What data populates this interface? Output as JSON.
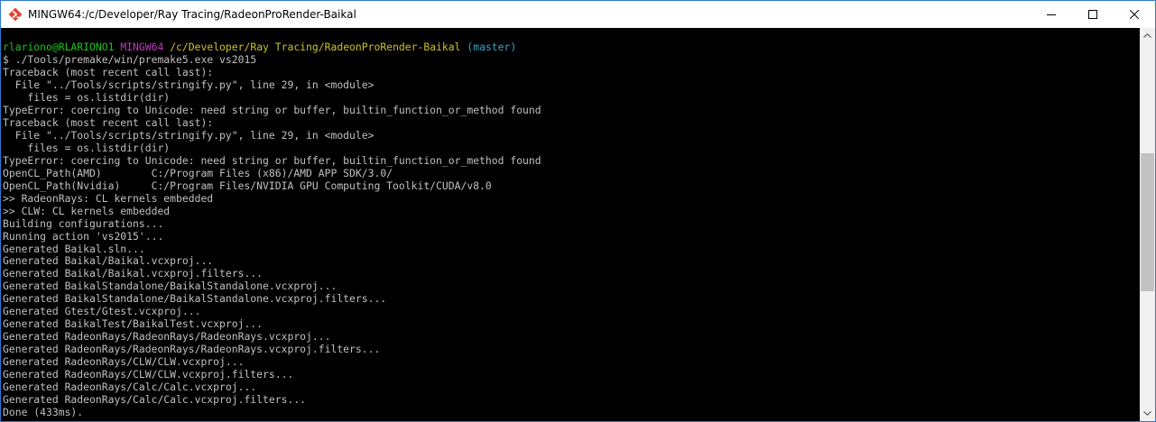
{
  "window": {
    "title": "MINGW64:/c/Developer/Ray Tracing/RadeonProRender-Baikal",
    "icon": "mingw-app-icon",
    "controls": [
      "minimize-icon",
      "maximize-icon",
      "close-icon"
    ]
  },
  "prompt": {
    "user_host": "rlariono@RLARIONO1",
    "env": "MINGW64",
    "path": "/c/Developer/Ray Tracing/RadeonProRender-Baikal",
    "branch": "(master)"
  },
  "output_lines": [
    "$ ./Tools/premake/win/premake5.exe vs2015",
    "Traceback (most recent call last):",
    "  File \"../Tools/scripts/stringify.py\", line 29, in <module>",
    "    files = os.listdir(dir)",
    "TypeError: coercing to Unicode: need string or buffer, builtin_function_or_method found",
    "Traceback (most recent call last):",
    "  File \"../Tools/scripts/stringify.py\", line 29, in <module>",
    "    files = os.listdir(dir)",
    "TypeError: coercing to Unicode: need string or buffer, builtin_function_or_method found",
    "OpenCL_Path(AMD)        C:/Program Files (x86)/AMD APP SDK/3.0/",
    "OpenCL_Path(Nvidia)     C:/Program Files/NVIDIA GPU Computing Toolkit/CUDA/v8.0",
    ">> RadeonRays: CL kernels embedded",
    ">> CLW: CL kernels embedded",
    "Building configurations...",
    "Running action 'vs2015'...",
    "Generated Baikal.sln...",
    "Generated Baikal/Baikal.vcxproj...",
    "Generated Baikal/Baikal.vcxproj.filters...",
    "Generated BaikalStandalone/BaikalStandalone.vcxproj...",
    "Generated BaikalStandalone/BaikalStandalone.vcxproj.filters...",
    "Generated Gtest/Gtest.vcxproj...",
    "Generated BaikalTest/BaikalTest.vcxproj...",
    "Generated RadeonRays/RadeonRays/RadeonRays.vcxproj...",
    "Generated RadeonRays/RadeonRays/RadeonRays.vcxproj.filters...",
    "Generated RadeonRays/CLW/CLW.vcxproj...",
    "Generated RadeonRays/CLW/CLW.vcxproj.filters...",
    "Generated RadeonRays/Calc/Calc.vcxproj...",
    "Generated RadeonRays/Calc/Calc.vcxproj.filters...",
    "Done (433ms)."
  ],
  "colors": {
    "background": "#000000",
    "text": "#c0c0c0",
    "user_host": "#1dc31d",
    "env": "#c239c2",
    "path": "#c7c427",
    "branch": "#3aa3c7",
    "window_border": "#2b79d0"
  },
  "scroll": {
    "position_fraction": 0.34,
    "visible_fraction": 0.38
  }
}
